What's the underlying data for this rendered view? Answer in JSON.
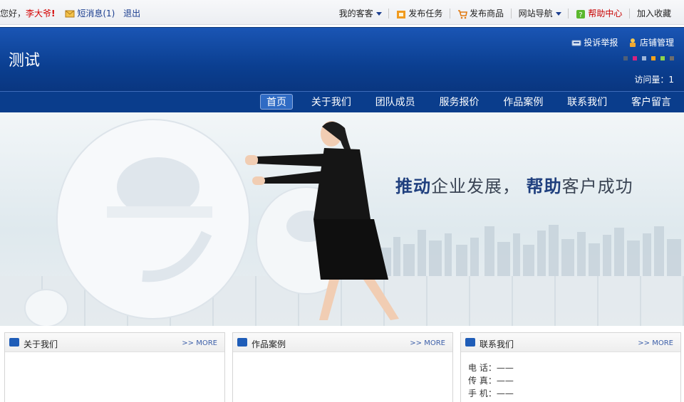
{
  "topbar": {
    "greeting": "您好，",
    "username": "李大爷",
    "excl": "!",
    "messages": "短消息(1)",
    "logout": "退出",
    "my_guest": "我的客客",
    "post_task": "发布任务",
    "post_goods": "发布商品",
    "site_nav": "网站导航",
    "help_center": "帮助中心",
    "add_favorite": "加入收藏"
  },
  "header": {
    "site_title": "测试",
    "report": "投诉举报",
    "shop_manage": "店铺管理",
    "theme_colors": [
      "#4f5f77",
      "#d6237f",
      "#9fb6d8",
      "#f5a21a",
      "#8cd34a",
      "#6d6d6d"
    ],
    "visits": "访问量：1"
  },
  "nav": {
    "items": [
      "首页",
      "关于我们",
      "团队成员",
      "服务报价",
      "作品案例",
      "联系我们",
      "客户留言"
    ]
  },
  "banner": {
    "slogan_1": "推动",
    "slogan_2": "企业发展，",
    "slogan_3": "帮助",
    "slogan_4": "客户成功"
  },
  "panels": {
    "about": {
      "title": "关于我们",
      "more": ">> MORE"
    },
    "works": {
      "title": "作品案例",
      "more": ">> MORE"
    },
    "contact": {
      "title": "联系我们",
      "more": ">> MORE",
      "phone": "电  话：——",
      "fax": "传  真：——",
      "mobile": "手  机：——"
    }
  }
}
